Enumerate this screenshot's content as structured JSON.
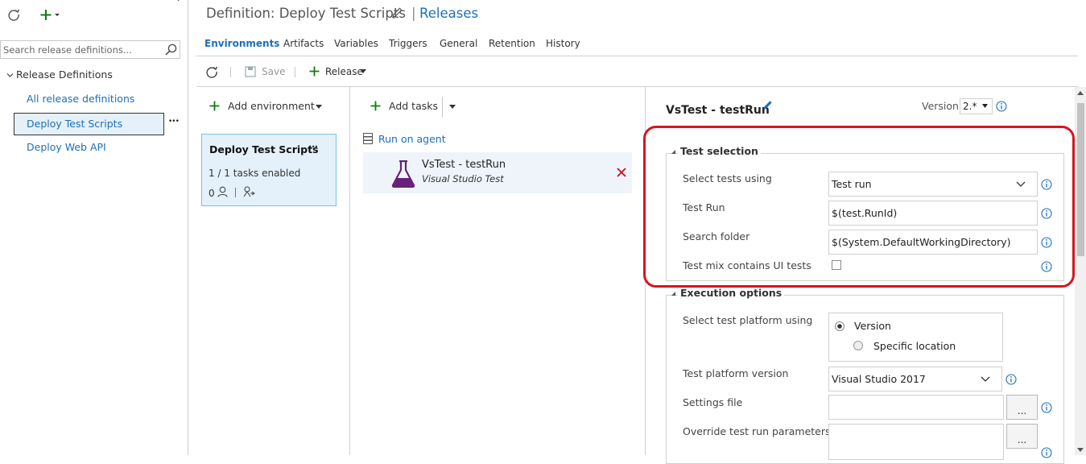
{
  "left": {
    "search_placeholder": "Search release definitions...",
    "tree_root": "Release Definitions",
    "items": [
      {
        "label": "All release definitions"
      },
      {
        "label": "Deploy Test Scripts"
      },
      {
        "label": "Deploy Web API"
      }
    ],
    "more": "•••"
  },
  "header": {
    "title": "Definition: Deploy Test Scripts",
    "separator": "|",
    "releases_link": "Releases"
  },
  "tabs": [
    {
      "label": "Environments"
    },
    {
      "label": "Artifacts"
    },
    {
      "label": "Variables"
    },
    {
      "label": "Triggers"
    },
    {
      "label": "General"
    },
    {
      "label": "Retention"
    },
    {
      "label": "History"
    }
  ],
  "toolbar": {
    "save": "Save",
    "release": "Release"
  },
  "environments": {
    "add_label": "Add environment",
    "card": {
      "name": "Deploy Test Scripts",
      "tasks": "1 / 1 tasks enabled",
      "approvers": "0",
      "more": "•••"
    }
  },
  "tasks": {
    "add_label": "Add tasks",
    "phase": "Run on agent",
    "item": {
      "name": "VsTest - testRun",
      "subtitle": "Visual Studio Test"
    }
  },
  "detail": {
    "title": "VsTest - testRun",
    "version_label": "Version",
    "version_value": "2.*",
    "test_selection": {
      "title": "Test selection",
      "select_tests_label": "Select tests using",
      "select_tests_value": "Test run",
      "test_run_label": "Test Run",
      "test_run_value": "$(test.RunId)",
      "search_folder_label": "Search folder",
      "search_folder_value": "$(System.DefaultWorkingDirectory)",
      "ui_tests_label": "Test mix contains UI tests"
    },
    "execution": {
      "title": "Execution options",
      "platform_label": "Select test platform using",
      "radio_version": "Version",
      "radio_location": "Specific location",
      "platform_version_label": "Test platform version",
      "platform_version_value": "Visual Studio 2017",
      "settings_label": "Settings file",
      "override_label": "Override test run parameters",
      "browse": "..."
    }
  },
  "colors": {
    "accent": "#1e6fb8",
    "add_green": "#107c10",
    "highlight_red": "#d9141e",
    "delete_red": "#c50f1f",
    "flask_purple": "#68217a",
    "selected_bg": "#e4f1fb"
  }
}
